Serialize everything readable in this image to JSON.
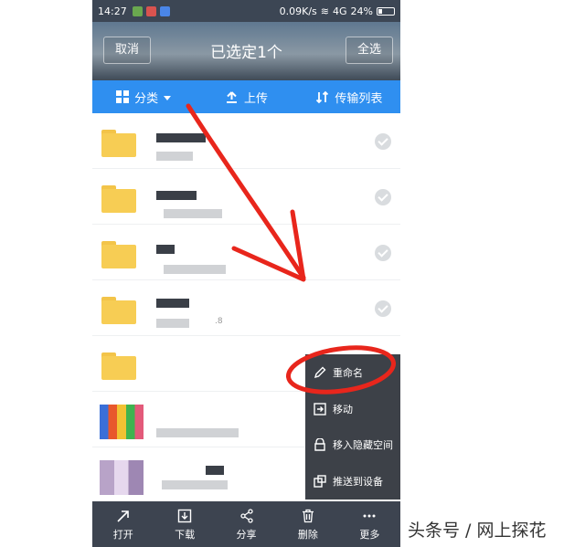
{
  "status_bar": {
    "time": "14:27",
    "network_speed": "0.09K/s",
    "network_type": "4G",
    "battery": "24%",
    "battery_level": 0.24
  },
  "header": {
    "cancel_label": "取消",
    "title": "已选定1个",
    "select_all_label": "全选"
  },
  "tabs": [
    {
      "label": "分类",
      "icon": "grid-icon"
    },
    {
      "label": "上传",
      "icon": "upload-icon"
    },
    {
      "label": "传输列表",
      "icon": "transfer-icon"
    }
  ],
  "file_list": {
    "rows": [
      {
        "type": "folder",
        "selected": false
      },
      {
        "type": "folder",
        "selected": false
      },
      {
        "type": "folder",
        "selected": false
      },
      {
        "type": "folder",
        "selected": false,
        "visible_fragment": ".8"
      },
      {
        "type": "folder",
        "selected": false
      },
      {
        "type": "image",
        "selected": true
      },
      {
        "type": "image",
        "selected": false
      }
    ]
  },
  "context_menu": {
    "items": [
      {
        "label": "重命名",
        "icon": "pencil-icon"
      },
      {
        "label": "移动",
        "icon": "move-icon"
      },
      {
        "label": "移入隐藏空间",
        "icon": "hidden-lock-icon"
      },
      {
        "label": "推送到设备",
        "icon": "push-device-icon"
      }
    ]
  },
  "bottom_bar": {
    "items": [
      {
        "label": "打开",
        "icon": "open-arrow-icon"
      },
      {
        "label": "下载",
        "icon": "download-icon"
      },
      {
        "label": "分享",
        "icon": "share-icon"
      },
      {
        "label": "删除",
        "icon": "trash-icon"
      },
      {
        "label": "更多",
        "icon": "more-icon"
      }
    ]
  },
  "watermark": "头条号 / 网上探花",
  "colors": {
    "accent_blue": "#2f8ff0",
    "annotation_red": "#e8261c",
    "bar_dark": "#3d4450",
    "folder_yellow": "#f7cd54"
  }
}
